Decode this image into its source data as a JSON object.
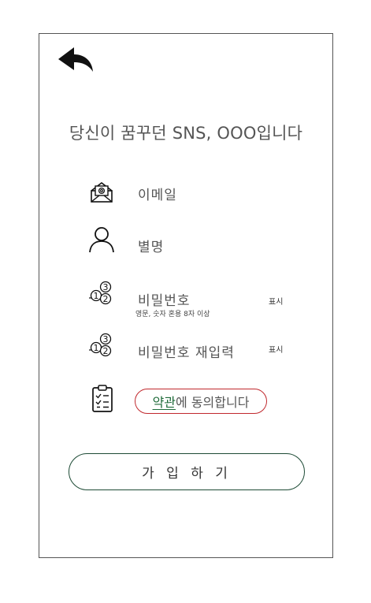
{
  "header": {
    "back_icon": "back-arrow-icon",
    "title": "당신이 꿈꾸던 SNS, OOO입니다"
  },
  "form": {
    "email": {
      "icon": "email-envelope-icon",
      "placeholder": "이메일"
    },
    "nickname": {
      "icon": "user-icon",
      "placeholder": "별명"
    },
    "password": {
      "icon": "password-keypad-icon",
      "placeholder": "비밀번호",
      "hint": "영문, 숫자 혼용 8자 이상",
      "show_label": "표시"
    },
    "password_confirm": {
      "icon": "password-keypad-icon",
      "placeholder": "비밀번호 재입력",
      "show_label": "표시"
    },
    "terms": {
      "icon": "checklist-clipboard-icon",
      "link_text": "약관",
      "suffix_text": "에 동의합니다",
      "accent_color": "#c0282d"
    }
  },
  "actions": {
    "signup_label": "가 입 하 기"
  }
}
